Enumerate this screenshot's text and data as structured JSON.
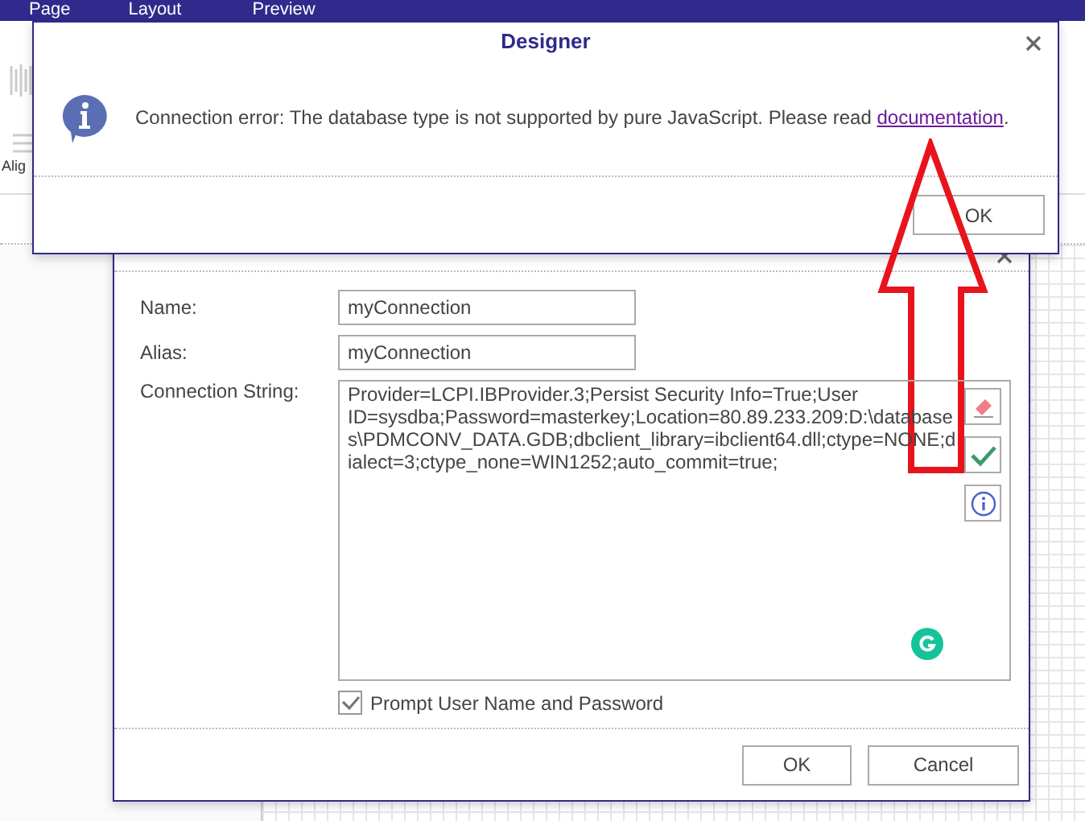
{
  "background": {
    "menu": [
      "Page",
      "Layout",
      "Preview"
    ],
    "toolbar_label": "Alig"
  },
  "connection_dialog": {
    "fields": [
      {
        "label": "Name:",
        "value": "myConnection"
      },
      {
        "label": "Alias:",
        "value": "myConnection"
      }
    ],
    "connection_string": {
      "label": "Connection String:",
      "value": "Provider=LCPI.IBProvider.3;Persist Security Info=True;User ID=sysdba;Password=masterkey;Location=80.89.233.209:D:\\databases\\PDMCONV_DATA.GDB;dbclient_library=ibclient64.dll;ctype=NONE;dialect=3;ctype_none=WIN1252;auto_commit=true;"
    },
    "prompt_checkbox": {
      "label": "Prompt User Name and Password",
      "checked": true
    },
    "buttons": [
      "OK",
      "Cancel"
    ]
  },
  "alert": {
    "title": "Designer",
    "message": "Connection error: The database type is not supported by pure JavaScript. Please read ",
    "link": "documentation",
    "message_end": ".",
    "button": "OK"
  }
}
